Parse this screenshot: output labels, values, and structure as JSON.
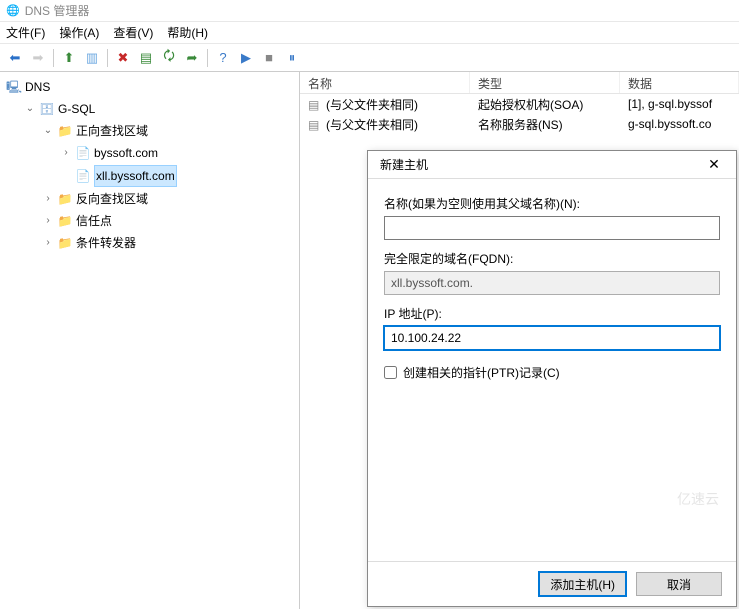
{
  "window": {
    "title": "DNS 管理器"
  },
  "menubar": {
    "file": "文件(F)",
    "action": "操作(A)",
    "view": "查看(V)",
    "help": "帮助(H)"
  },
  "tree": {
    "root": "DNS",
    "server": "G-SQL",
    "forward_zone": "正向查找区域",
    "zone_byssoft": "byssoft.com",
    "zone_xll": "xll.byssoft.com",
    "reverse_zone": "反向查找区域",
    "trust_points": "信任点",
    "cond_forwarders": "条件转发器"
  },
  "list": {
    "headers": {
      "name": "名称",
      "type": "类型",
      "data": "数据"
    },
    "rows": [
      {
        "name": "(与父文件夹相同)",
        "type": "起始授权机构(SOA)",
        "data": "[1], g-sql.byssof"
      },
      {
        "name": "(与父文件夹相同)",
        "type": "名称服务器(NS)",
        "data": "g-sql.byssoft.co"
      }
    ]
  },
  "dialog": {
    "title": "新建主机",
    "name_label": "名称(如果为空则使用其父域名称)(N):",
    "name_value": "",
    "fqdn_label": "完全限定的域名(FQDN):",
    "fqdn_value": "xll.byssoft.com.",
    "ip_label": "IP 地址(P):",
    "ip_value": "10.100.24.22",
    "ptr_checkbox": "创建相关的指针(PTR)记录(C)",
    "add_button": "添加主机(H)",
    "cancel_button": "取消"
  },
  "watermark": "亿速云"
}
